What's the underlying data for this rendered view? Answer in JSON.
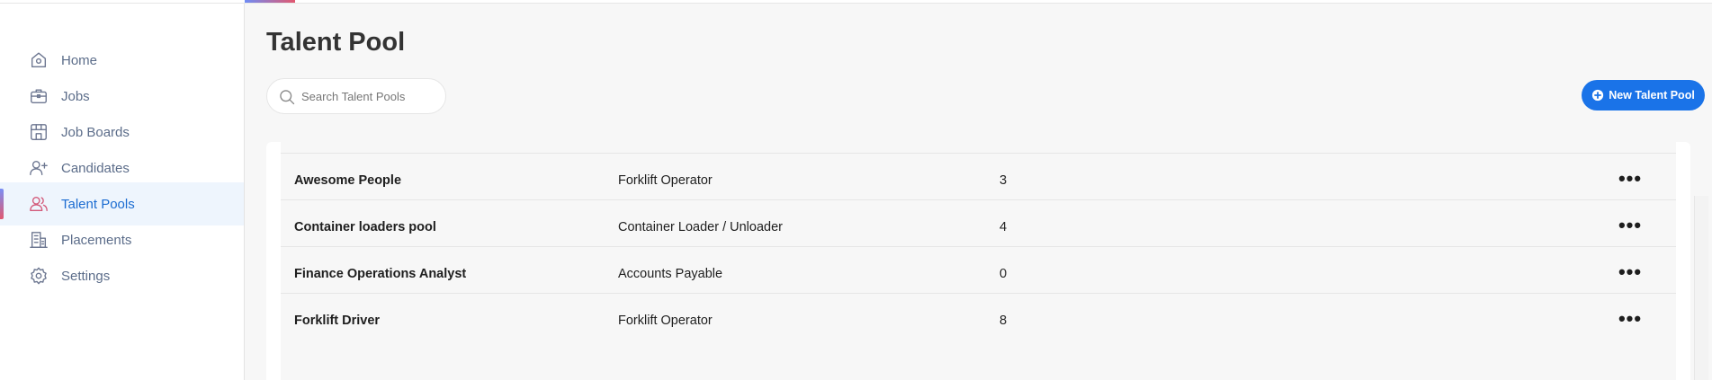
{
  "sidebar": {
    "items": [
      {
        "label": "Home",
        "icon": "home-icon"
      },
      {
        "label": "Jobs",
        "icon": "briefcase-icon"
      },
      {
        "label": "Job Boards",
        "icon": "storefront-icon"
      },
      {
        "label": "Candidates",
        "icon": "user-plus-icon"
      },
      {
        "label": "Talent Pools",
        "icon": "users-icon",
        "active": true
      },
      {
        "label": "Placements",
        "icon": "building-icon"
      },
      {
        "label": "Settings",
        "icon": "gear-icon"
      }
    ]
  },
  "main": {
    "title": "Talent Pool",
    "search": {
      "placeholder": "Search Talent Pools",
      "value": ""
    },
    "new_button": "New Talent Pool"
  },
  "table": {
    "rows": [
      {
        "name": "Awesome People",
        "job": "Forklift Operator",
        "count": "3"
      },
      {
        "name": "Container loaders pool",
        "job": "Container Loader / Unloader",
        "count": "4"
      },
      {
        "name": "Finance Operations Analyst",
        "job": "Accounts Payable",
        "count": "0"
      },
      {
        "name": "Forklift Driver",
        "job": "Forklift Operator",
        "count": "8"
      }
    ],
    "row_menu": "•••"
  },
  "colors": {
    "accent": "#1a73e8",
    "active_bg": "#eef5fd",
    "gradient_start": "#7a8ff5",
    "gradient_end": "#e2586f"
  }
}
